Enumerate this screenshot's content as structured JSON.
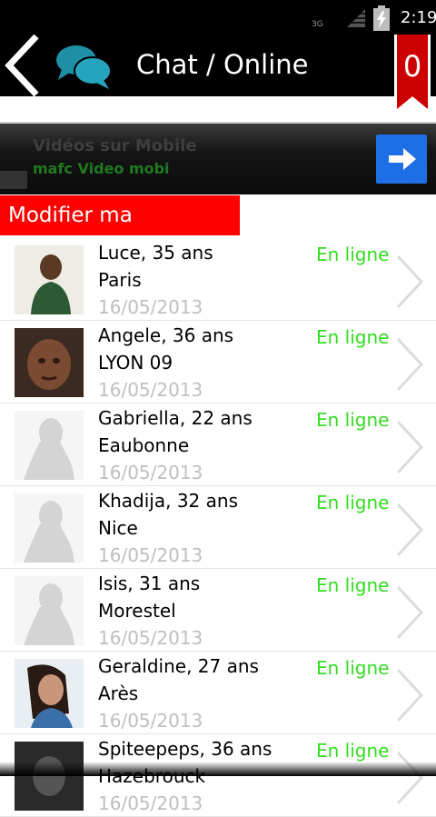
{
  "status_bar": {
    "network": "3G",
    "time": "2:19"
  },
  "header": {
    "title": "Chat / Online",
    "badge_count": "0"
  },
  "ad": {
    "title": "Vidéos sur Mobile",
    "subtitle": "mafc Video mobi"
  },
  "search_button": "Modifier ma recherche",
  "members": [
    {
      "name": "Luce, 35 ans",
      "city": "Paris",
      "date": "16/05/2013",
      "status": "En ligne",
      "photo": "photo"
    },
    {
      "name": "Angele, 36 ans",
      "city": "LYON 09",
      "date": "16/05/2013",
      "status": "En ligne",
      "photo": "photo"
    },
    {
      "name": "Gabriella, 22 ans",
      "city": "Eaubonne",
      "date": "16/05/2013",
      "status": "En ligne",
      "photo": "placeholder"
    },
    {
      "name": "Khadija, 32 ans",
      "city": "Nice",
      "date": "16/05/2013",
      "status": "En ligne",
      "photo": "placeholder"
    },
    {
      "name": "Isis, 31 ans",
      "city": "Morestel",
      "date": "16/05/2013",
      "status": "En ligne",
      "photo": "placeholder"
    },
    {
      "name": "Geraldine, 27 ans",
      "city": "Arès",
      "date": "16/05/2013",
      "status": "En ligne",
      "photo": "photo"
    },
    {
      "name": "Spiteepeps, 36 ans",
      "city": "Hazebrouck",
      "date": "16/05/2013",
      "status": "En ligne",
      "photo": "photo"
    }
  ],
  "colors": {
    "accent_red": "#ff0000",
    "online_green": "#33dd22",
    "header_bg": "#000000",
    "ad_button": "#1e6fe6"
  }
}
